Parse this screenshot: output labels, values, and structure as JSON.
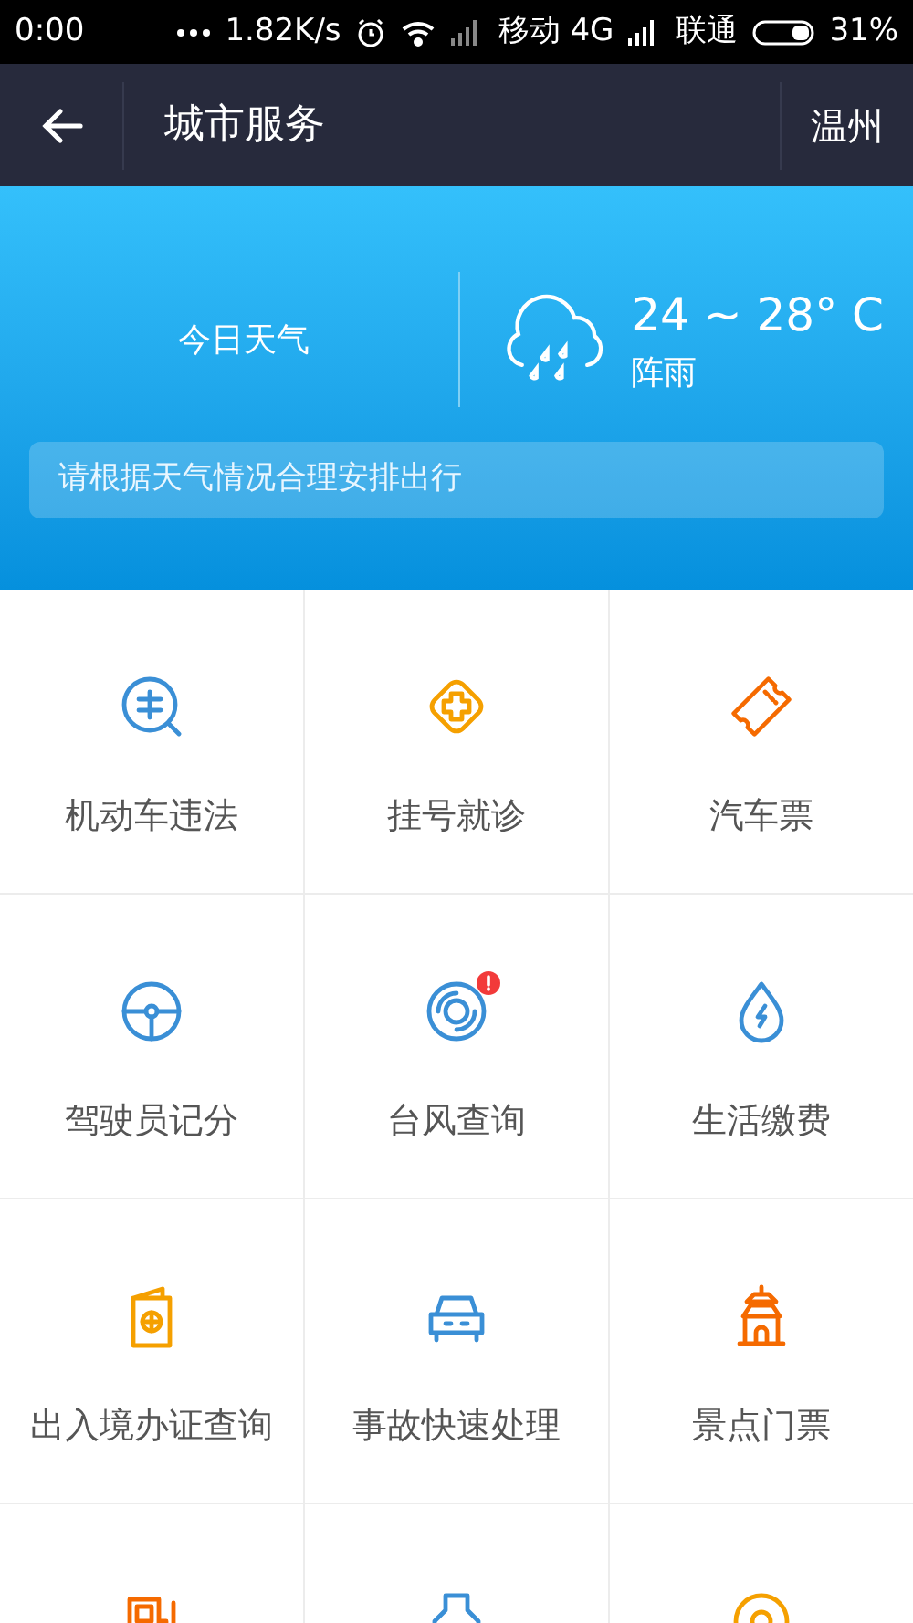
{
  "status_bar": {
    "time": "0:00",
    "speed": "1.82K/s",
    "carrier_1": "移动 4G",
    "carrier_2": "联通",
    "battery": "31%"
  },
  "header": {
    "title": "城市服务",
    "city": "温州"
  },
  "weather": {
    "label": "今日天气",
    "temperature": "24 ~ 28° C",
    "condition": "阵雨",
    "tip": "请根据天气情况合理安排出行"
  },
  "services": [
    {
      "kind": "violation",
      "color": "#3a8fd6",
      "label": "机动车违法",
      "badge": false
    },
    {
      "kind": "clinic",
      "color": "#f5a000",
      "label": "挂号就诊",
      "badge": false
    },
    {
      "kind": "ticket",
      "color": "#f56a00",
      "label": "汽车票",
      "badge": false
    },
    {
      "kind": "wheel",
      "color": "#3a8fd6",
      "label": "驾驶员记分",
      "badge": false
    },
    {
      "kind": "typhoon",
      "color": "#3a8fd6",
      "label": "台风查询",
      "badge": true
    },
    {
      "kind": "drop",
      "color": "#3a8fd6",
      "label": "生活缴费",
      "badge": false
    },
    {
      "kind": "passport",
      "color": "#f5a000",
      "label": "出入境办证查询",
      "badge": false
    },
    {
      "kind": "car",
      "color": "#3a8fd6",
      "label": "事故快速处理",
      "badge": false
    },
    {
      "kind": "landmark",
      "color": "#f56a00",
      "label": "景点门票",
      "badge": false
    },
    {
      "kind": "fuel",
      "color": "#f56a00",
      "badge": false
    },
    {
      "kind": "bottle",
      "color": "#3a8fd6",
      "badge": false
    },
    {
      "kind": "coin",
      "color": "#f5a000",
      "badge": false
    }
  ]
}
